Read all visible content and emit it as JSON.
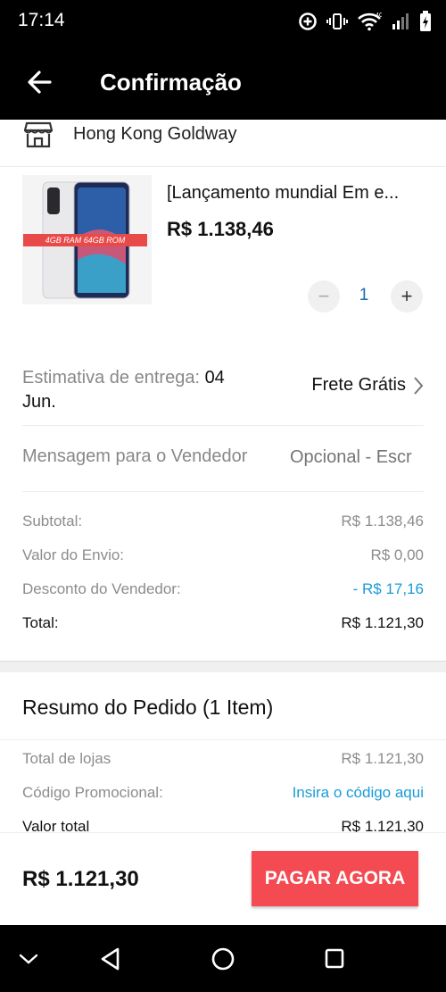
{
  "status_bar": {
    "time": "17:14",
    "network": "4G"
  },
  "header": {
    "title": "Confirmação"
  },
  "store": {
    "name": "Hong Kong Goldway"
  },
  "product": {
    "title": "[Lançamento mundial Em e...",
    "price": "R$ 1.138,46",
    "image_banner": "4GB RAM 64GB ROM",
    "quantity": "1",
    "minus_label": "−",
    "plus_label": "+"
  },
  "delivery": {
    "estimate_label": "Estimativa de entrega:",
    "estimate_date": "04",
    "estimate_date_line2": "Jun.",
    "shipping": "Frete Grátis"
  },
  "message": {
    "label": "Mensagem para o Vendedor",
    "placeholder": "Opcional - Escr"
  },
  "costs": {
    "subtotal_label": "Subtotal:",
    "subtotal_value": "R$ 1.138,46",
    "shipping_label": "Valor do Envio:",
    "shipping_value": "R$ 0,00",
    "discount_label": "Desconto do Vendedor:",
    "discount_value": "- R$ 17,16",
    "total_label": "Total:",
    "total_value": "R$ 1.121,30"
  },
  "summary": {
    "title": "Resumo do Pedido (1 Item)",
    "stores_total_label": "Total de lojas",
    "stores_total_value": "R$ 1.121,30",
    "promo_label": "Código Promocional:",
    "promo_link": "Insira o código aqui",
    "grand_total_label": "Valor total",
    "grand_total_value": "R$ 1.121,30"
  },
  "footer": {
    "total": "R$ 1.121,30",
    "pay_button": "PAGAR AGORA"
  },
  "colors": {
    "accent_red": "#f44a52",
    "link_blue": "#1a9bd7",
    "status_black": "#000000"
  }
}
